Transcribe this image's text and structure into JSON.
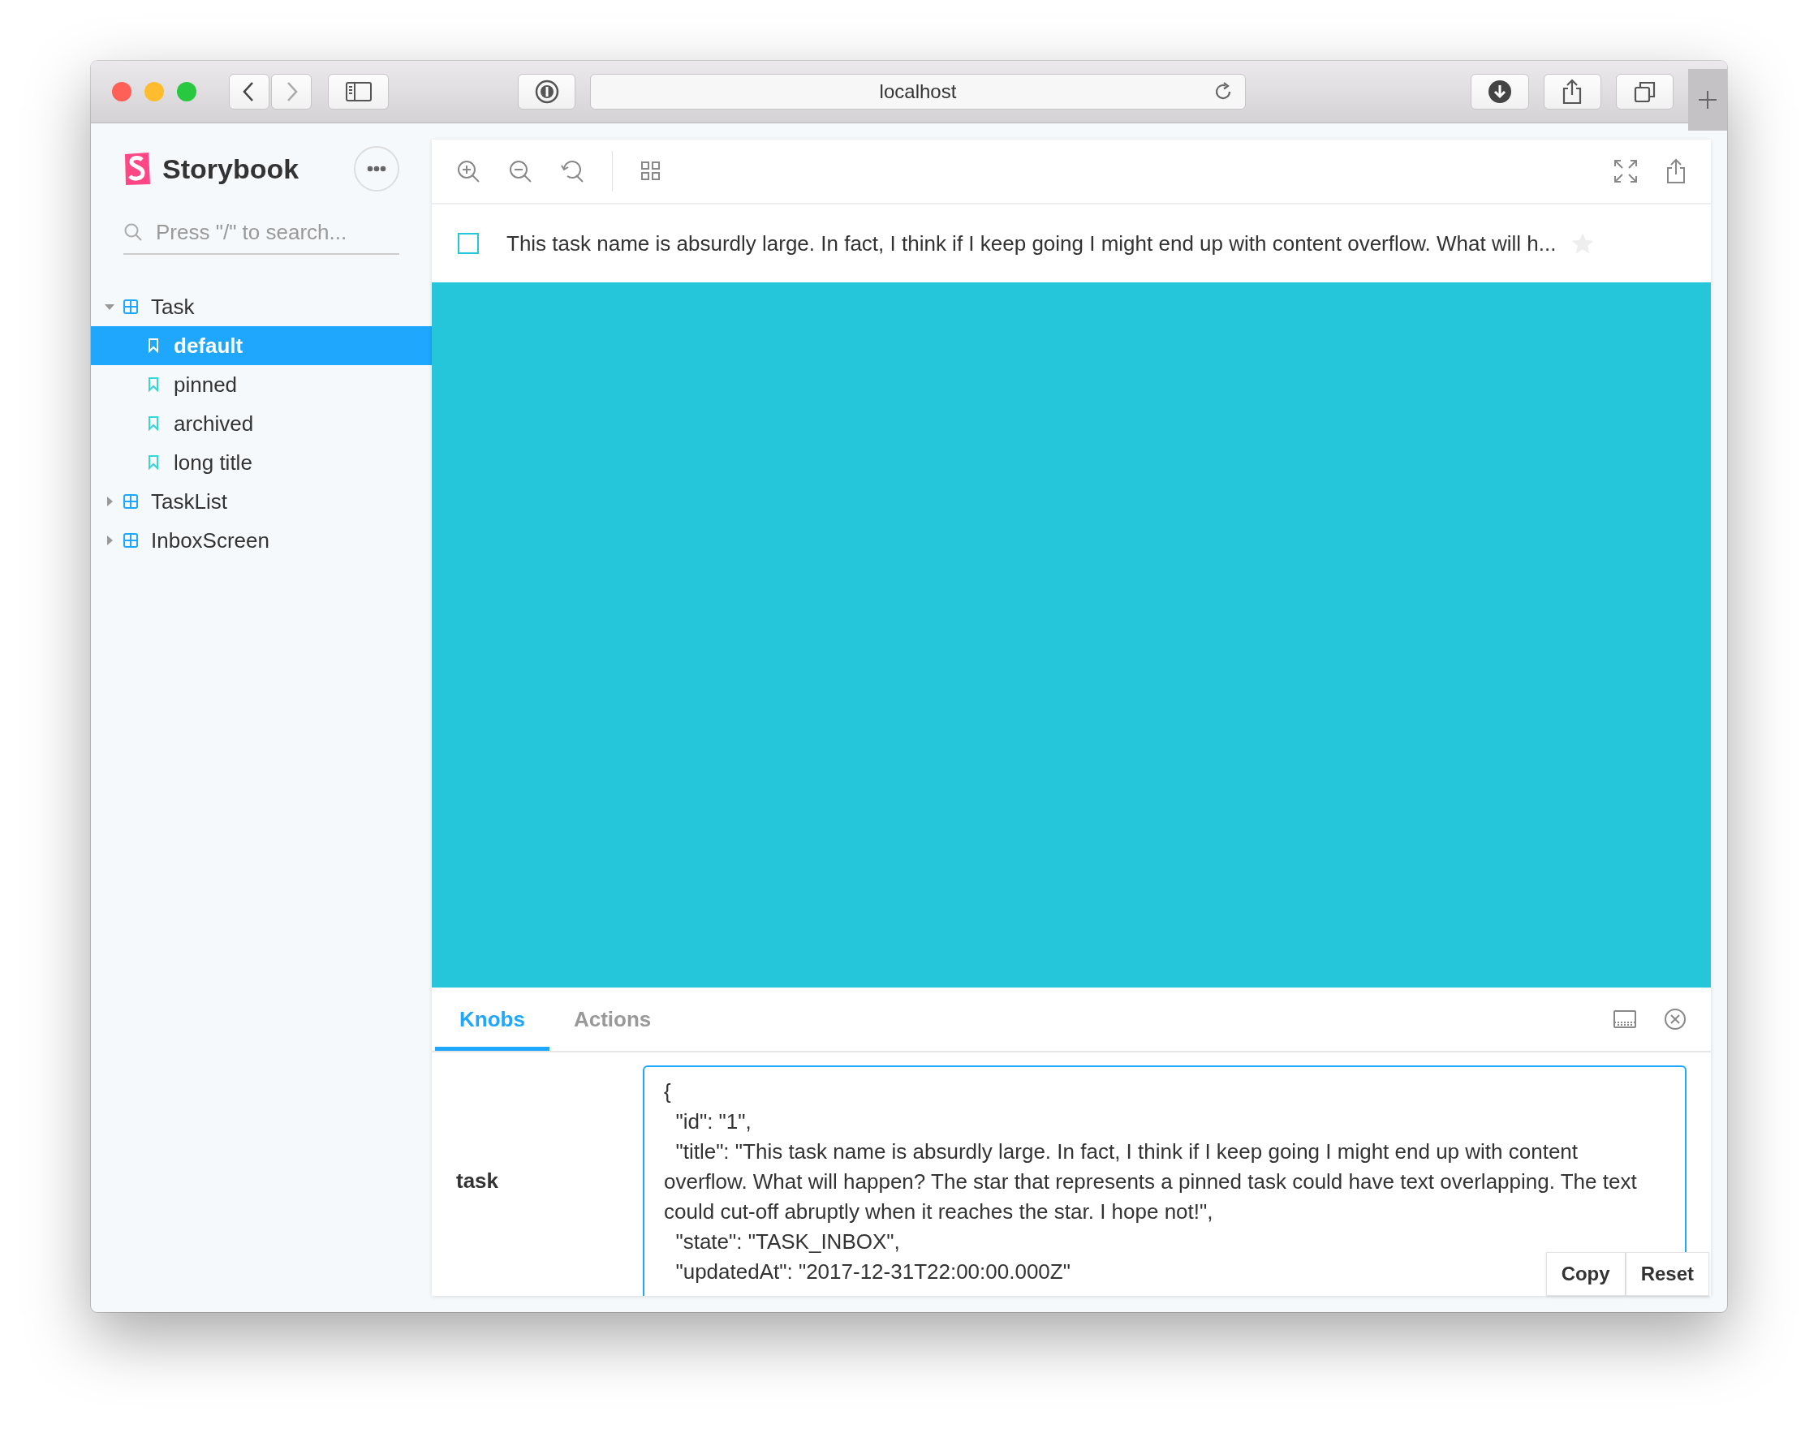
{
  "browser": {
    "url": "localhost"
  },
  "sidebar": {
    "brand": "Storybook",
    "search": {
      "placeholder": "Press \"/\" to search..."
    },
    "tree": [
      {
        "label": "Task",
        "expanded": true,
        "selected": false,
        "children": [
          {
            "label": "default",
            "selected": true
          },
          {
            "label": "pinned",
            "selected": false
          },
          {
            "label": "archived",
            "selected": false
          },
          {
            "label": "long title",
            "selected": false
          }
        ]
      },
      {
        "label": "TaskList",
        "expanded": false,
        "selected": false
      },
      {
        "label": "InboxScreen",
        "expanded": false,
        "selected": false
      }
    ]
  },
  "task": {
    "title": "This task name is absurdly large. In fact, I think if I keep going I might end up with content overflow. What will h...",
    "checked": false,
    "pinned": false
  },
  "addons": {
    "tabs": [
      {
        "label": "Knobs",
        "selected": true
      },
      {
        "label": "Actions",
        "selected": false
      }
    ],
    "knobs": [
      {
        "label": "task",
        "value": "{\n  \"id\": \"1\",\n  \"title\": \"This task name is absurdly large. In fact, I think if I keep going I might end up with content overflow. What will happen? The star that represents a pinned task could have text overlapping. The text could cut-off abruptly when it reaches the star. I hope not!\",\n  \"state\": \"TASK_INBOX\",\n  \"updatedAt\": \"2017-12-31T22:00:00.000Z\"",
        "buttons": [
          "Copy",
          "Reset"
        ]
      }
    ]
  }
}
